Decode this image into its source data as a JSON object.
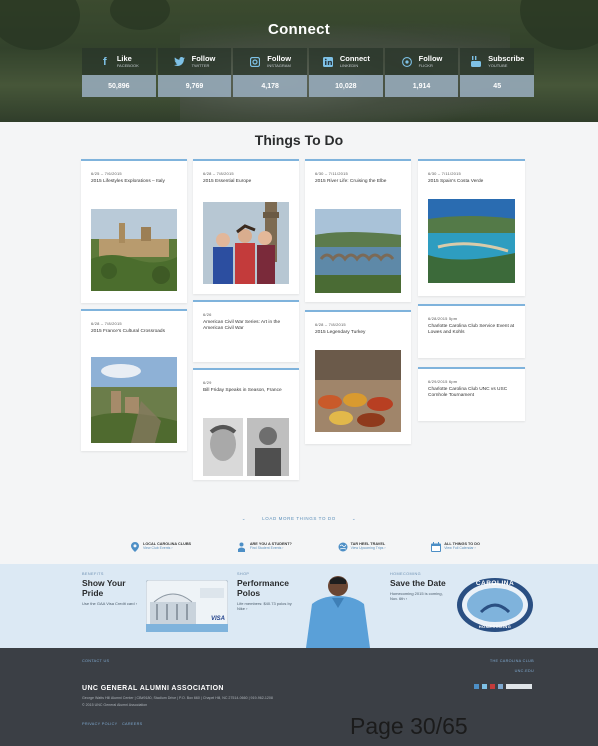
{
  "connect": {
    "title": "Connect",
    "channels": [
      {
        "icon": "facebook-icon",
        "label": "Like",
        "sub": "FACEBOOK",
        "count": "50,896"
      },
      {
        "icon": "twitter-icon",
        "label": "Follow",
        "sub": "TWITTER",
        "count": "9,769"
      },
      {
        "icon": "instagram-icon",
        "label": "Follow",
        "sub": "INSTAGRAM",
        "count": "4,178"
      },
      {
        "icon": "linkedin-icon",
        "label": "Connect",
        "sub": "LINKEDIN",
        "count": "10,028"
      },
      {
        "icon": "flickr-icon",
        "label": "Follow",
        "sub": "FLICKR",
        "count": "1,914"
      },
      {
        "icon": "youtube-icon",
        "label": "Subscribe",
        "sub": "YOUTUBE",
        "count": "45"
      }
    ]
  },
  "things": {
    "title": "Things To Do",
    "cards": [
      {
        "date": "6/25 – 7/6/2015",
        "title": "2015 Lifestyles Explorations – Italy"
      },
      {
        "date": "6/28 – 7/8/2015",
        "title": "2015 Essential Europe"
      },
      {
        "date": "6/30 – 7/11/2015",
        "title": "2015 River Life: Cruising the Elbe"
      },
      {
        "date": "6/30 – 7/11/2015",
        "title": "2015 Spain's Costa Verde"
      },
      {
        "date": "6/28 – 7/8/2015",
        "title": "2015 France's Cultural Crossroads"
      },
      {
        "date": "6/26",
        "title": "American Civil War Series: Art in the American Civil War"
      },
      {
        "date": "6/28 – 7/8/2015",
        "title": "2015 Legendary Turkey"
      },
      {
        "date": "6/28/2015 5pm",
        "title": "Charlotte Carolina Club Service Event at Lowes and Kohls"
      },
      {
        "date": "6/29",
        "title": "Bill Friday Speaks in Season, France"
      },
      {
        "date": "6/29/2015 6pm",
        "title": "Charlotte Carolina Club UNC vs USC Cornhole Tournament"
      }
    ]
  },
  "load_more": "LOAD MORE THINGS TO DO",
  "quick_links": [
    {
      "icon": "map-pin-icon",
      "title": "LOCAL CAROLINA CLUBS",
      "sub": "View Club Events ›"
    },
    {
      "icon": "student-icon",
      "title": "ARE YOU A STUDENT?",
      "sub": "Find Student Events ›"
    },
    {
      "icon": "globe-icon",
      "title": "TAR HEEL TRAVEL",
      "sub": "View Upcoming Trips ›"
    },
    {
      "icon": "calendar-icon",
      "title": "ALL THINGS TO DO",
      "sub": "View Full Calendar ›"
    }
  ],
  "promos": [
    {
      "kicker": "BENEFITS",
      "heading": "Show Your Pride",
      "sub": "Use the GAA Visa Credit card ›"
    },
    {
      "kicker": "SHOP",
      "heading": "Performance Polos",
      "sub": "Life members: $40.73 polos by Nike ›"
    },
    {
      "kicker": "HOMECOMING",
      "heading": "Save the Date",
      "sub": "Homecoming 2015 is coming, Nov. 6th ›"
    }
  ],
  "seal": {
    "top": "CAROLINA",
    "bottom": "HOMECOMING"
  },
  "card_visa": "VISA",
  "footer": {
    "contact": "CONTACT US",
    "carolina_club": "THE CAROLINA CLUB",
    "unc_edu": "UNC.EDU",
    "org": "UNC GENERAL ALUMNI ASSOCIATION",
    "address": "George Watts Hill Alumni Center | CB#9180, Stadium Drive | P.O. Box 660 | Chapel Hill, NC 27514-0660 | 919-962-1208",
    "copyright": "© 2015 UNC General Alumni Association",
    "privacy": "PRIVACY POLICY",
    "careers": "CAREERS"
  },
  "page_indicator": "Page 30/65"
}
